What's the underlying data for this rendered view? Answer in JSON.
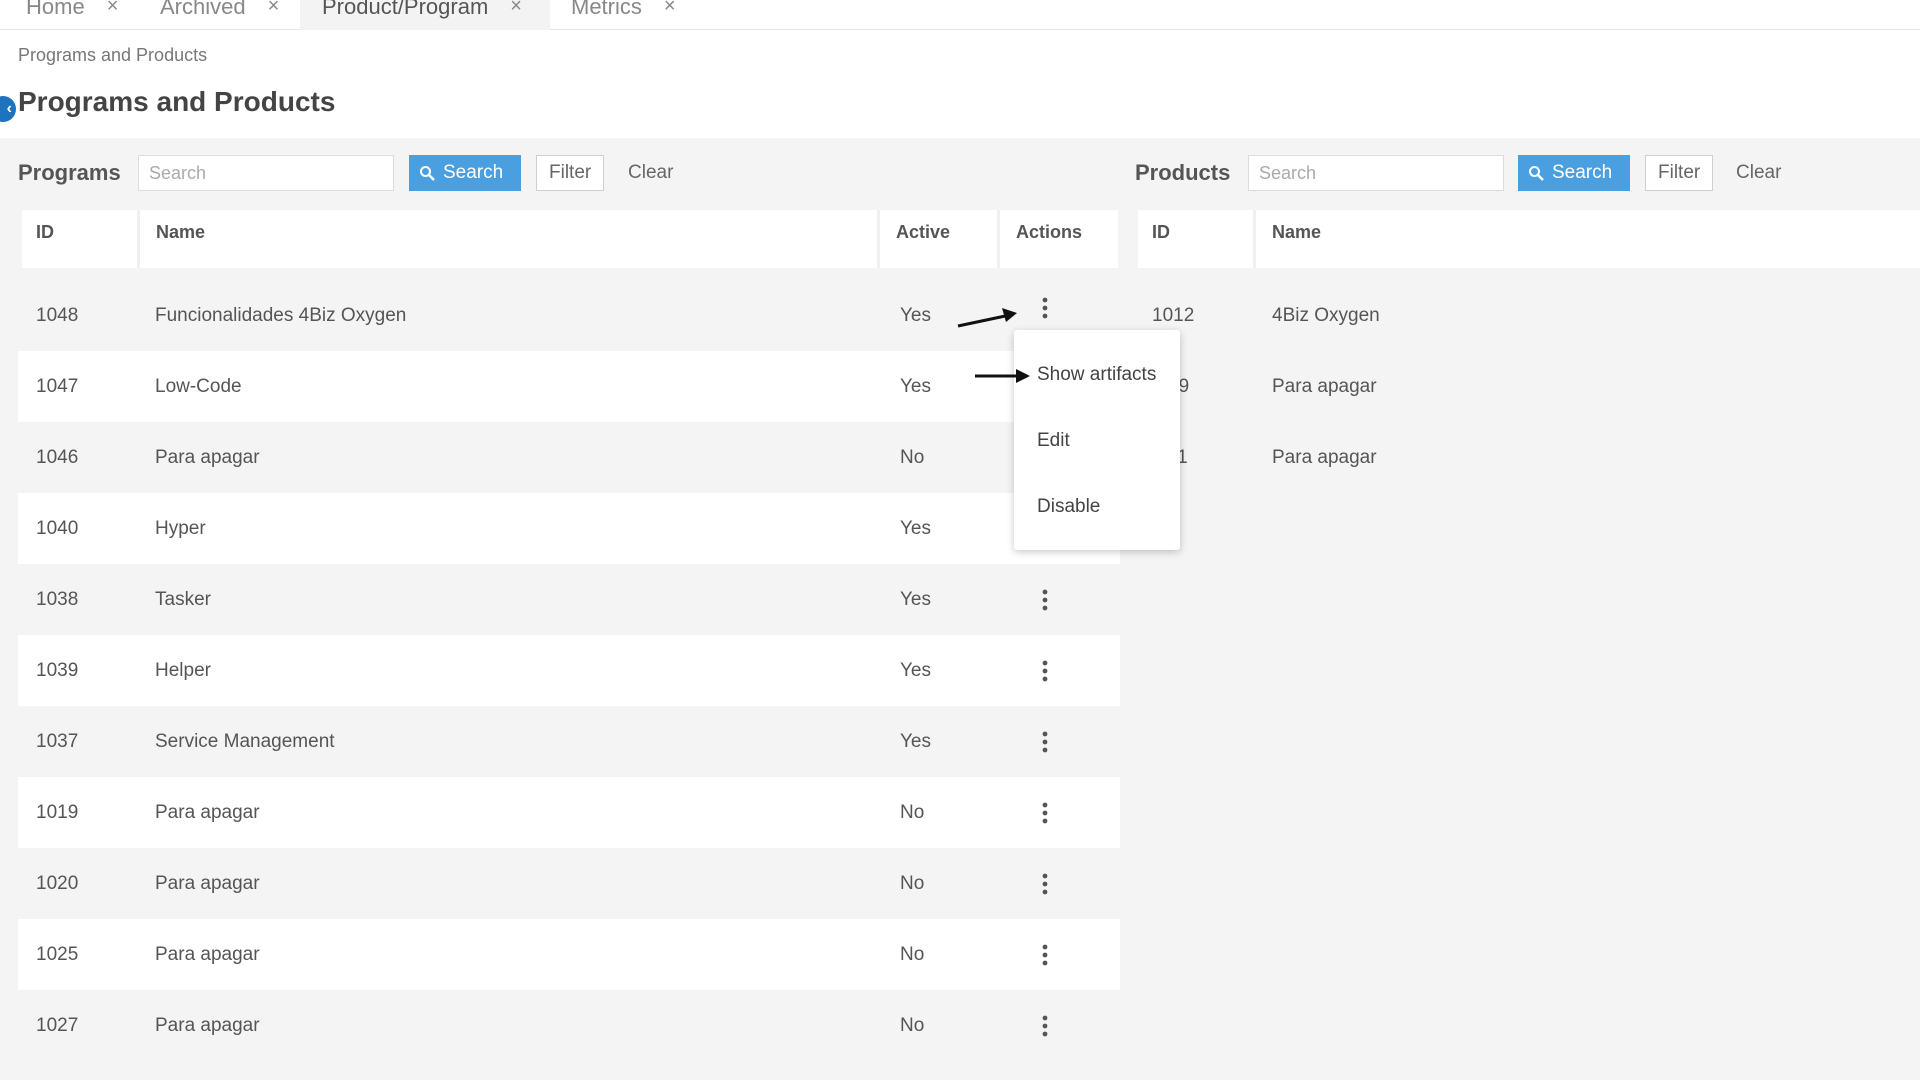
{
  "tabs": [
    {
      "label": "Home",
      "close": "×"
    },
    {
      "label": "Archived",
      "close": "×"
    },
    {
      "label": "Product/Program",
      "close": "×"
    },
    {
      "label": "Metrics",
      "close": "×"
    }
  ],
  "breadcrumb": "Programs and Products",
  "page_title": "Programs and Products",
  "collapse_icon_glyph": "‹",
  "programs": {
    "title": "Programs",
    "search_placeholder": "Search",
    "search_label": "Search",
    "filter_label": "Filter",
    "clear_label": "Clear",
    "columns": [
      "ID",
      "Name",
      "Active",
      "Actions"
    ],
    "rows": [
      {
        "id": "1048",
        "name": "Funcionalidades 4Biz Oxygen",
        "active": "Yes"
      },
      {
        "id": "1047",
        "name": "Low-Code",
        "active": "Yes"
      },
      {
        "id": "1046",
        "name": "Para apagar",
        "active": "No"
      },
      {
        "id": "1040",
        "name": "Hyper",
        "active": "Yes"
      },
      {
        "id": "1038",
        "name": "Tasker",
        "active": "Yes"
      },
      {
        "id": "1039",
        "name": "Helper",
        "active": "Yes"
      },
      {
        "id": "1037",
        "name": "Service Management",
        "active": "Yes"
      },
      {
        "id": "1019",
        "name": "Para apagar",
        "active": "No"
      },
      {
        "id": "1020",
        "name": "Para apagar",
        "active": "No"
      },
      {
        "id": "1025",
        "name": "Para apagar",
        "active": "No"
      },
      {
        "id": "1027",
        "name": "Para apagar",
        "active": "No"
      }
    ]
  },
  "products": {
    "title": "Products",
    "search_placeholder": "Search",
    "search_label": "Search",
    "filter_label": "Filter",
    "clear_label": "Clear",
    "columns": [
      "ID",
      "Name"
    ],
    "rows": [
      {
        "id": "1012",
        "name": "4Biz Oxygen"
      },
      {
        "id": "09",
        "name": "Para apagar"
      },
      {
        "id": "11",
        "name": "Para apagar"
      }
    ]
  },
  "context_menu": {
    "items": [
      "Show artifacts",
      "Edit",
      "Disable"
    ]
  },
  "colors": {
    "accent": "#4a9fe0",
    "collapse": "#1e73be"
  },
  "icons": {
    "search": "search-icon",
    "more": "more-vertical-icon",
    "close": "close-icon",
    "arrow": "arrow-annotation"
  }
}
